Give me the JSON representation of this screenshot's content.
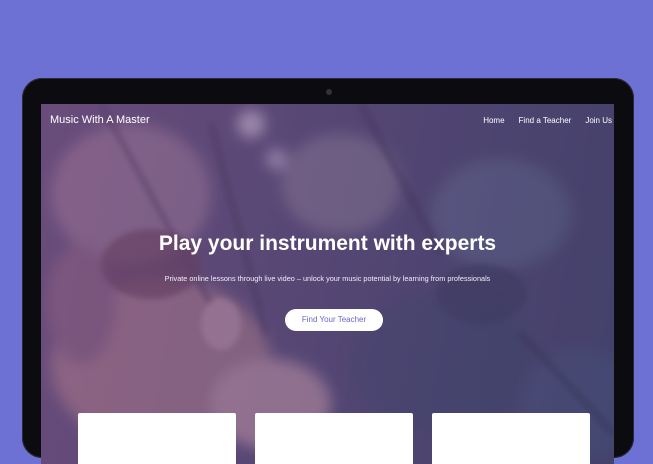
{
  "brand": {
    "name": "Music With A Master"
  },
  "nav": {
    "links": [
      {
        "label": "Home"
      },
      {
        "label": "Find a Teacher"
      },
      {
        "label": "Join Us"
      }
    ]
  },
  "hero": {
    "title": "Play your instrument with experts",
    "subtitle": "Private online lessons through live video – unlock your music potential by learning from professionals",
    "cta_label": "Find Your Teacher"
  },
  "colors": {
    "background": "#6d71d3",
    "overlay": "#7a5a96",
    "button_text": "#6b66c8"
  }
}
